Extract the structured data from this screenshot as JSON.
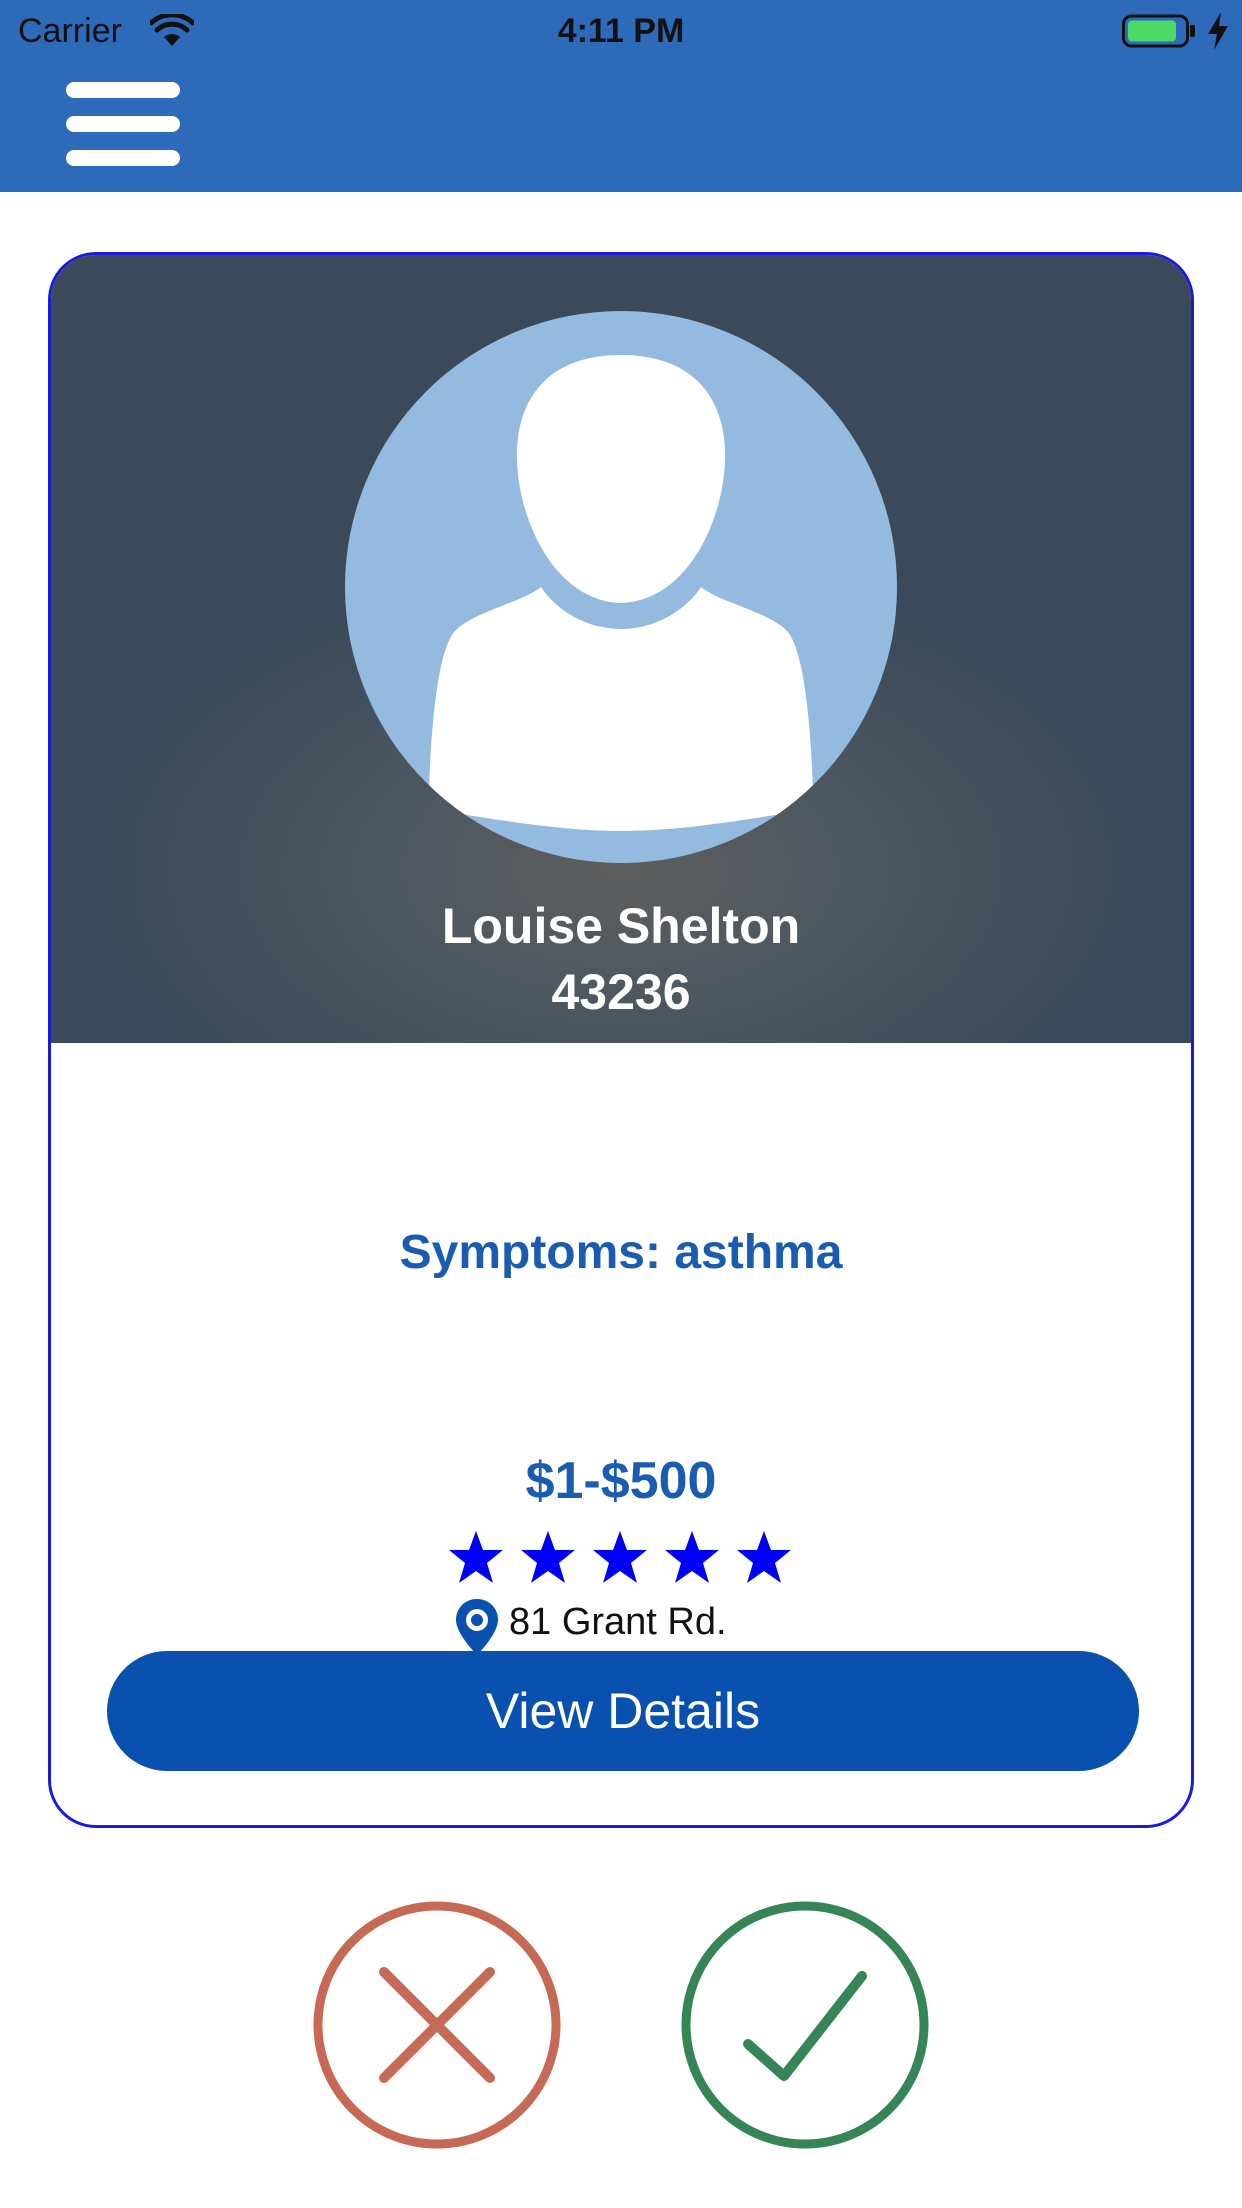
{
  "status_bar": {
    "carrier": "Carrier",
    "time": "4:11 PM",
    "icons": [
      "wifi-icon",
      "battery-icon",
      "charging-bolt-icon"
    ]
  },
  "nav": {
    "menu_icon": "hamburger-menu-icon",
    "bar_color": "#2d6aba"
  },
  "card": {
    "avatar_icon": "user-placeholder-icon",
    "name": "Louise Shelton",
    "id": "43236",
    "symptoms": "Symptoms: asthma",
    "price_range": "$1-$500",
    "rating": 5,
    "rating_max": 5,
    "location_icon": "map-pin-icon",
    "address": "81 Grant Rd.",
    "view_details_label": "View Details",
    "accent_color": "#0a50ae",
    "border_color": "#1a1adf"
  },
  "actions": {
    "reject_icon": "close-icon",
    "accept_icon": "checkmark-icon",
    "reject_color": "#c76a55",
    "accept_color": "#358556"
  }
}
